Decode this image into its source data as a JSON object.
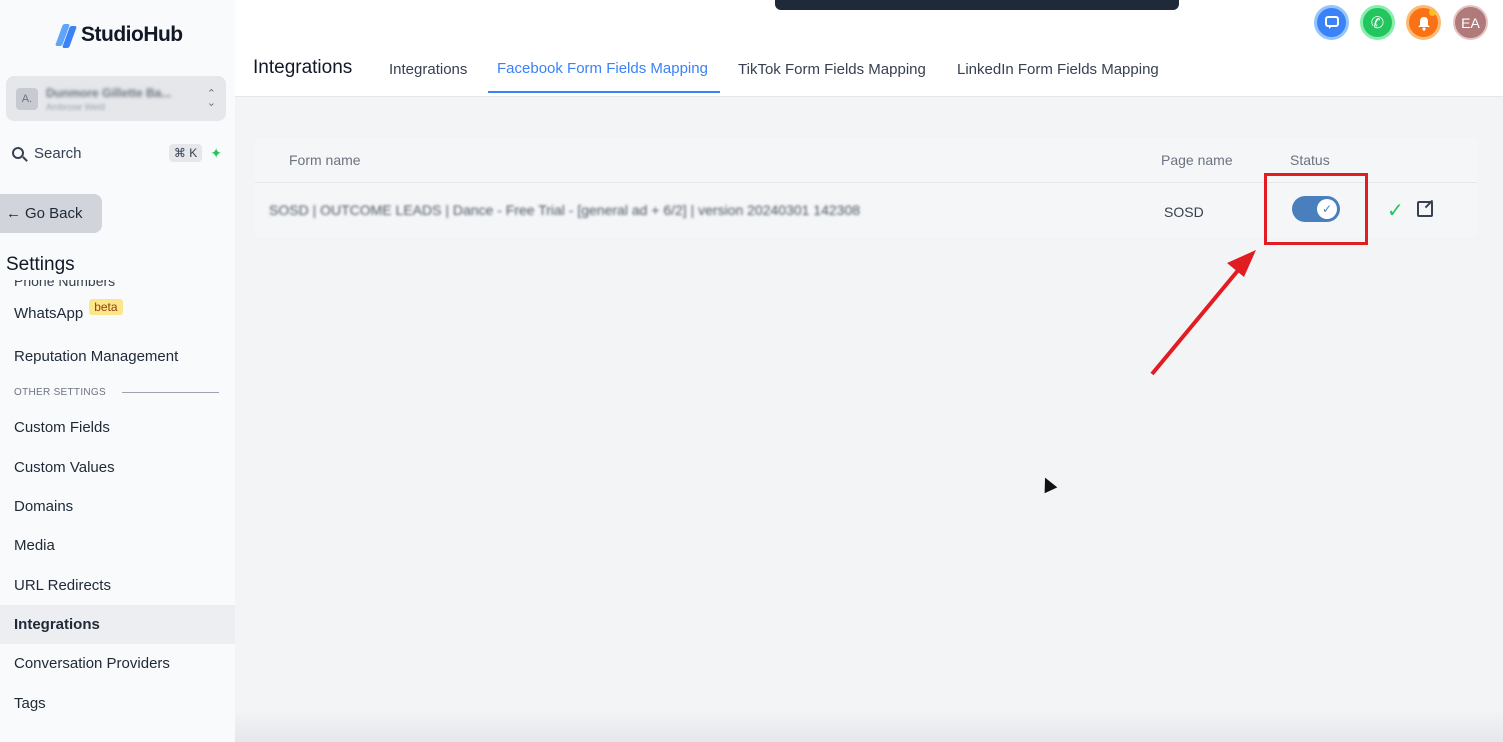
{
  "brand": {
    "name": "StudioHub"
  },
  "account": {
    "name": "Dunmore Gillette Ba...",
    "sub": "Ambrose Weld",
    "avatar": "A."
  },
  "search": {
    "label": "Search",
    "shortcut": "⌘ K"
  },
  "sidebar": {
    "go_back": "Go Back",
    "title": "Settings",
    "cut_item": "Phone Numbers",
    "items": [
      {
        "label": "WhatsApp",
        "badge": "beta"
      },
      {
        "label": "Reputation Management"
      }
    ],
    "section": "OTHER SETTINGS",
    "other_items": [
      {
        "label": "Custom Fields"
      },
      {
        "label": "Custom Values"
      },
      {
        "label": "Domains"
      },
      {
        "label": "Media"
      },
      {
        "label": "URL Redirects"
      },
      {
        "label": "Integrations",
        "active": true
      },
      {
        "label": "Conversation Providers"
      },
      {
        "label": "Tags"
      }
    ]
  },
  "header": {
    "title": "Integrations",
    "tabs": [
      {
        "label": "Integrations"
      },
      {
        "label": "Facebook Form Fields Mapping",
        "active": true
      },
      {
        "label": "TikTok Form Fields Mapping"
      },
      {
        "label": "LinkedIn Form Fields Mapping"
      }
    ],
    "avatar_initials": "EA"
  },
  "table": {
    "columns": [
      "Form name",
      "Page name",
      "Status"
    ],
    "rows": [
      {
        "form_name": "SOSD | OUTCOME LEADS | Dance - Free Trial - [general ad + 6/2] | version 20240301 142308",
        "page_name": "SOSD",
        "status_on": true
      }
    ]
  },
  "colors": {
    "accent": "#3b82f6",
    "annotation": "#e11d22",
    "toggle": "#4a7fbd"
  }
}
